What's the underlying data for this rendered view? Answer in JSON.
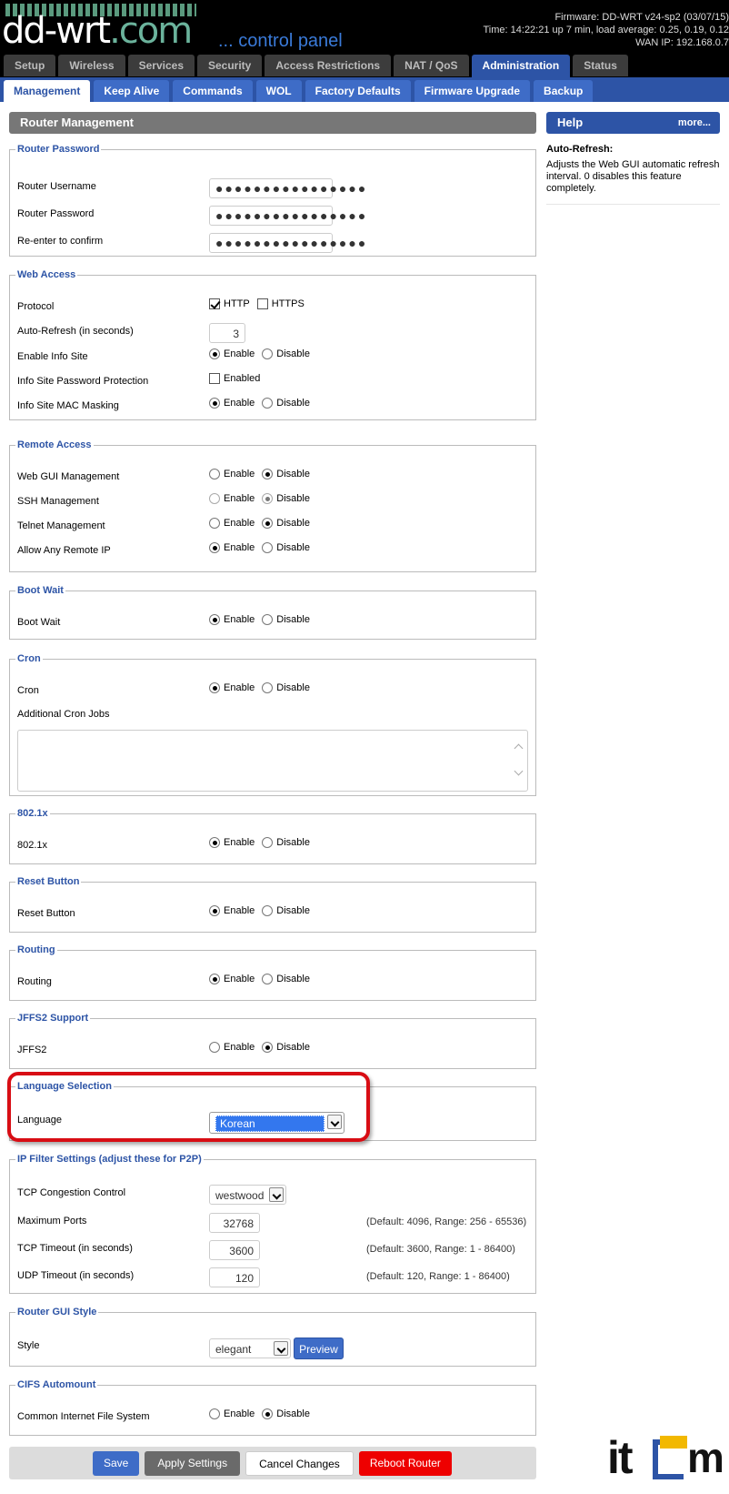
{
  "header": {
    "logo_main": "dd-wrt",
    "logo_suffix": ".com",
    "tagline": "... control panel",
    "firmware": "Firmware: DD-WRT v24-sp2 (03/07/15)",
    "time": "Time: 14:22:21 up 7 min, load average: 0.25, 0.19, 0.12",
    "wan_ip": "WAN IP: 192.168.0.7"
  },
  "main_tabs": [
    {
      "label": "Setup",
      "active": false
    },
    {
      "label": "Wireless",
      "active": false
    },
    {
      "label": "Services",
      "active": false
    },
    {
      "label": "Security",
      "active": false
    },
    {
      "label": "Access Restrictions",
      "active": false
    },
    {
      "label": "NAT / QoS",
      "active": false
    },
    {
      "label": "Administration",
      "active": true
    },
    {
      "label": "Status",
      "active": false
    }
  ],
  "sub_tabs": [
    {
      "label": "Management",
      "active": true
    },
    {
      "label": "Keep Alive",
      "active": false
    },
    {
      "label": "Commands",
      "active": false
    },
    {
      "label": "WOL",
      "active": false
    },
    {
      "label": "Factory Defaults",
      "active": false
    },
    {
      "label": "Firmware Upgrade",
      "active": false
    },
    {
      "label": "Backup",
      "active": false
    }
  ],
  "page_title": "Router Management",
  "help": {
    "title": "Help",
    "more": "more...",
    "heading": "Auto-Refresh:",
    "text": "Adjusts the Web GUI automatic refresh interval. 0 disables this feature completely."
  },
  "common": {
    "enable": "Enable",
    "disable": "Disable",
    "enabled": "Enabled"
  },
  "router_password": {
    "legend": "Router Password",
    "username_label": "Router Username",
    "password_label": "Router Password",
    "confirm_label": "Re-enter to confirm",
    "masked": "●●●●●●●●●●●●●●●●"
  },
  "web_access": {
    "legend": "Web Access",
    "protocol_label": "Protocol",
    "http": "HTTP",
    "https": "HTTPS",
    "refresh_label": "Auto-Refresh (in seconds)",
    "refresh_value": "3",
    "info_site_label": "Enable Info Site",
    "info_pwd_label": "Info Site Password Protection",
    "info_mac_label": "Info Site MAC Masking"
  },
  "remote_access": {
    "legend": "Remote Access",
    "web_gui_label": "Web GUI Management",
    "ssh_label": "SSH Management",
    "telnet_label": "Telnet Management",
    "any_ip_label": "Allow Any Remote IP"
  },
  "boot_wait": {
    "legend": "Boot Wait",
    "label": "Boot Wait"
  },
  "cron": {
    "legend": "Cron",
    "label": "Cron",
    "jobs_label": "Additional Cron Jobs"
  },
  "dot1x": {
    "legend": "802.1x",
    "label": "802.1x"
  },
  "reset_button": {
    "legend": "Reset Button",
    "label": "Reset Button"
  },
  "routing": {
    "legend": "Routing",
    "label": "Routing"
  },
  "jffs2": {
    "legend": "JFFS2 Support",
    "label": "JFFS2"
  },
  "language": {
    "legend": "Language Selection",
    "label": "Language",
    "value": "Korean"
  },
  "ip_filter": {
    "legend": "IP Filter Settings (adjust these for P2P)",
    "tcp_cc_label": "TCP Congestion Control",
    "tcp_cc_value": "westwood",
    "max_ports_label": "Maximum Ports",
    "max_ports_value": "32768",
    "max_ports_note": "(Default: 4096, Range: 256 - 65536)",
    "tcp_timeout_label": "TCP Timeout (in seconds)",
    "tcp_timeout_value": "3600",
    "tcp_timeout_note": "(Default: 3600, Range: 1 - 86400)",
    "udp_timeout_label": "UDP Timeout (in seconds)",
    "udp_timeout_value": "120",
    "udp_timeout_note": "(Default: 120, Range: 1 - 86400)"
  },
  "gui_style": {
    "legend": "Router GUI Style",
    "label": "Style",
    "value": "elegant",
    "preview": "Preview"
  },
  "cifs": {
    "legend": "CIFS Automount",
    "label": "Common Internet File System"
  },
  "footer": {
    "save": "Save",
    "apply": "Apply Settings",
    "cancel": "Cancel Changes",
    "reboot": "Reboot Router"
  },
  "colors": {
    "accent": "#2d54a6",
    "reboot": "#ee0000",
    "highlight": "#d80d14"
  },
  "watermark": {
    "left": "it",
    "right": "m"
  }
}
